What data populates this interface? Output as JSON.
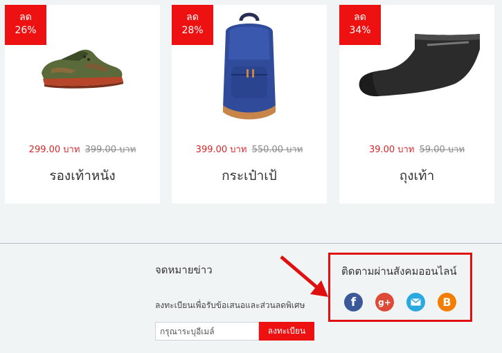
{
  "products": [
    {
      "badge_line1": "ลด",
      "badge_line2": "26%",
      "price_now": "299.00 บาท",
      "price_old": "399.00 บาท",
      "name": "รองเท้าหนัง"
    },
    {
      "badge_line1": "ลด",
      "badge_line2": "28%",
      "price_now": "399.00 บาท",
      "price_old": "550.00 บาท",
      "name": "กระเป๋าเป้"
    },
    {
      "badge_line1": "ลด",
      "badge_line2": "34%",
      "price_now": "39.00 บาท",
      "price_old": "59.00 บาท",
      "name": "ถุงเท้า"
    }
  ],
  "newsletter": {
    "title": "จดหมายข่าว",
    "subtitle": "ลงทะเบียนเพื่อรับข้อเสนอและส่วนลดพิเศษ",
    "placeholder": "กรุณาระบุอีเมล์",
    "button": "ลงทะเบียน"
  },
  "social": {
    "title": "ติดตามผ่านสังคมออนไลน์",
    "icons": [
      "facebook-icon",
      "google-plus-icon",
      "email-icon",
      "blogger-icon"
    ]
  },
  "colors": {
    "accent_red": "#ee1111",
    "price_red": "#d8262a",
    "background": "#f0f4f5"
  }
}
